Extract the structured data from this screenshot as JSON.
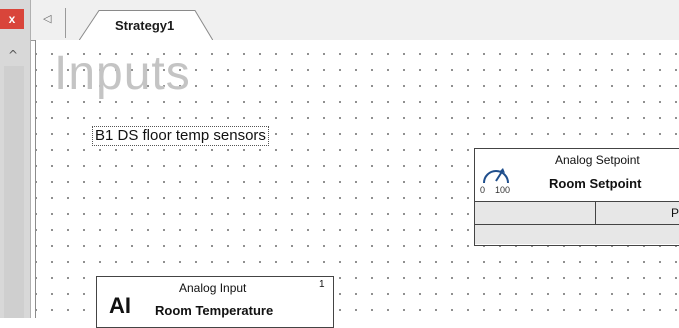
{
  "left_panel": {
    "close_glyph": "x",
    "scroll_up_glyph": "^"
  },
  "tabs": {
    "scroll_glyph": "◁",
    "active_tab_label": "Strategy1"
  },
  "canvas": {
    "heading": "Inputs",
    "text_label": "B1 DS floor temp sensors"
  },
  "analog_setpoint": {
    "type_label": "Analog Setpoint",
    "name": "Room Setpoint",
    "gauge_min": "0",
    "gauge_max": "100",
    "cell_text": "Poin"
  },
  "analog_input": {
    "abbr": "AI",
    "type_label": "Analog Input",
    "index": "1",
    "name": "Room Temperature"
  },
  "colors": {
    "close_red": "#d9453a",
    "heading_gray": "#c4c4c4",
    "row_fill": "#e7e7e7"
  }
}
